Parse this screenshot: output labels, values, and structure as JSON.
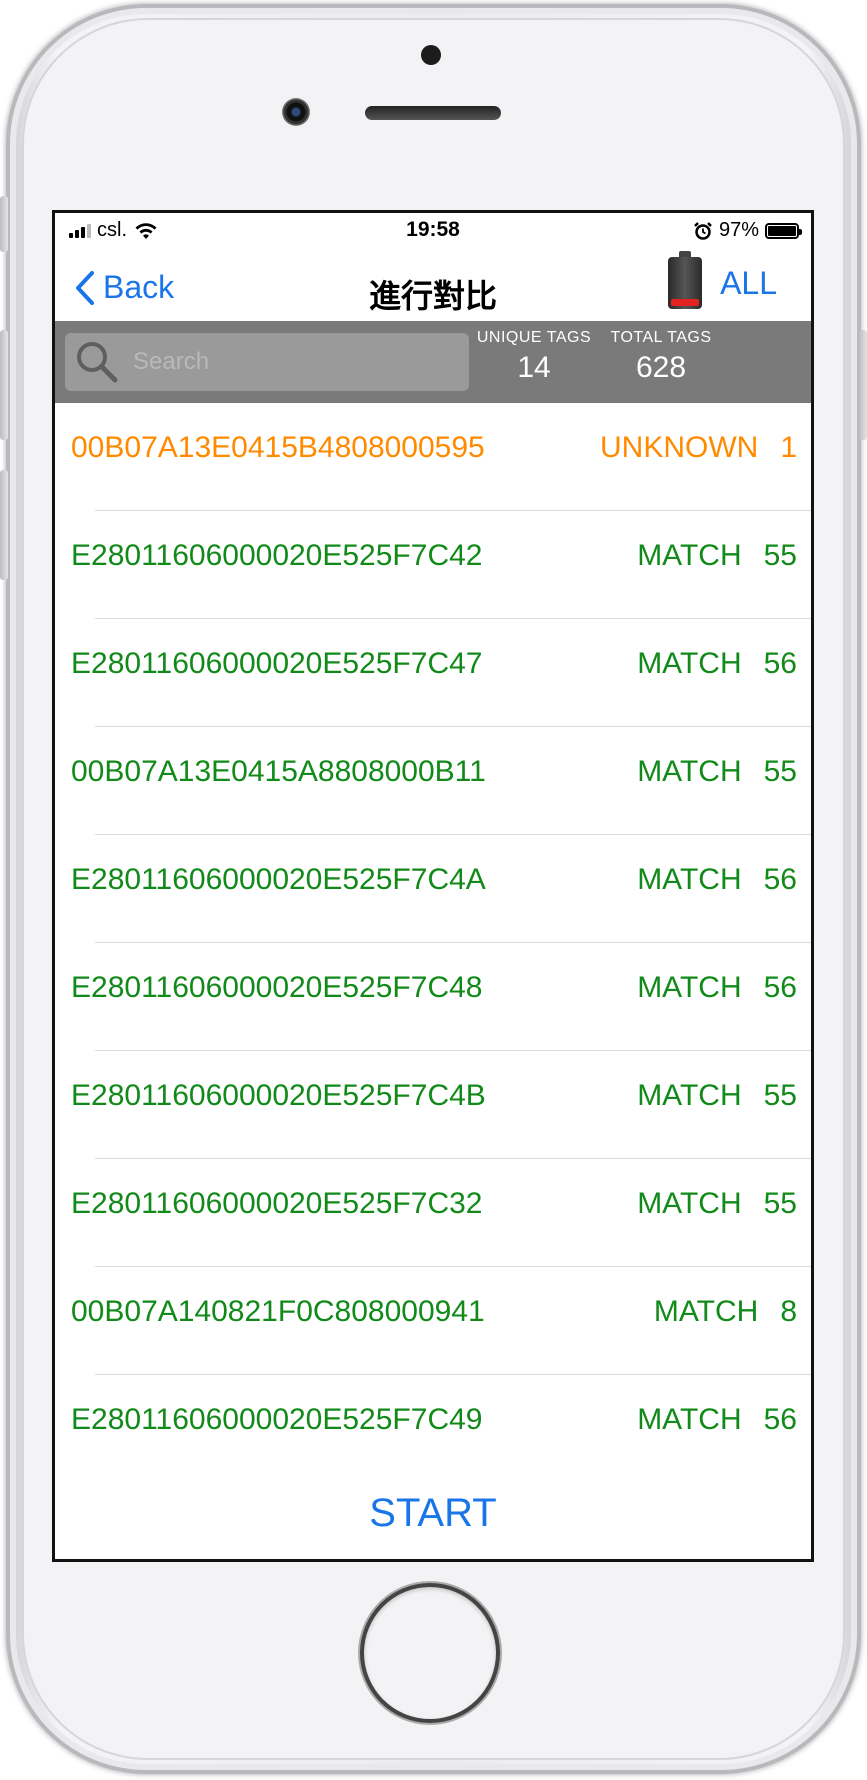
{
  "status_bar": {
    "carrier": "csl.",
    "time": "19:58",
    "battery_percent": "97%"
  },
  "nav": {
    "back_label": "Back",
    "title": "進行對比",
    "filter_label": "ALL",
    "reader_battery_level": 0.15
  },
  "search": {
    "placeholder": "Search"
  },
  "stats": {
    "unique_label": "UNIQUE TAGS",
    "unique_value": "14",
    "total_label": "TOTAL TAGS",
    "total_value": "628"
  },
  "rows": [
    {
      "tag": "00B07A13E0415B4808000595",
      "status": "UNKNOWN",
      "count": "1"
    },
    {
      "tag": "E28011606000020E525F7C42",
      "status": "MATCH",
      "count": "55"
    },
    {
      "tag": "E28011606000020E525F7C47",
      "status": "MATCH",
      "count": "56"
    },
    {
      "tag": "00B07A13E0415A8808000B11",
      "status": "MATCH",
      "count": "55"
    },
    {
      "tag": "E28011606000020E525F7C4A",
      "status": "MATCH",
      "count": "56"
    },
    {
      "tag": "E28011606000020E525F7C48",
      "status": "MATCH",
      "count": "56"
    },
    {
      "tag": "E28011606000020E525F7C4B",
      "status": "MATCH",
      "count": "55"
    },
    {
      "tag": "E28011606000020E525F7C32",
      "status": "MATCH",
      "count": "55"
    },
    {
      "tag": "00B07A140821F0C808000941",
      "status": "MATCH",
      "count": "8"
    },
    {
      "tag": "E28011606000020E525F7C49",
      "status": "MATCH",
      "count": "56"
    }
  ],
  "start_label": "START",
  "colors": {
    "accent": "#1a76e8",
    "match": "#118a19",
    "unknown": "#ff8a00",
    "header_bg": "#7a7a7a",
    "battery_low": "#e32222"
  }
}
